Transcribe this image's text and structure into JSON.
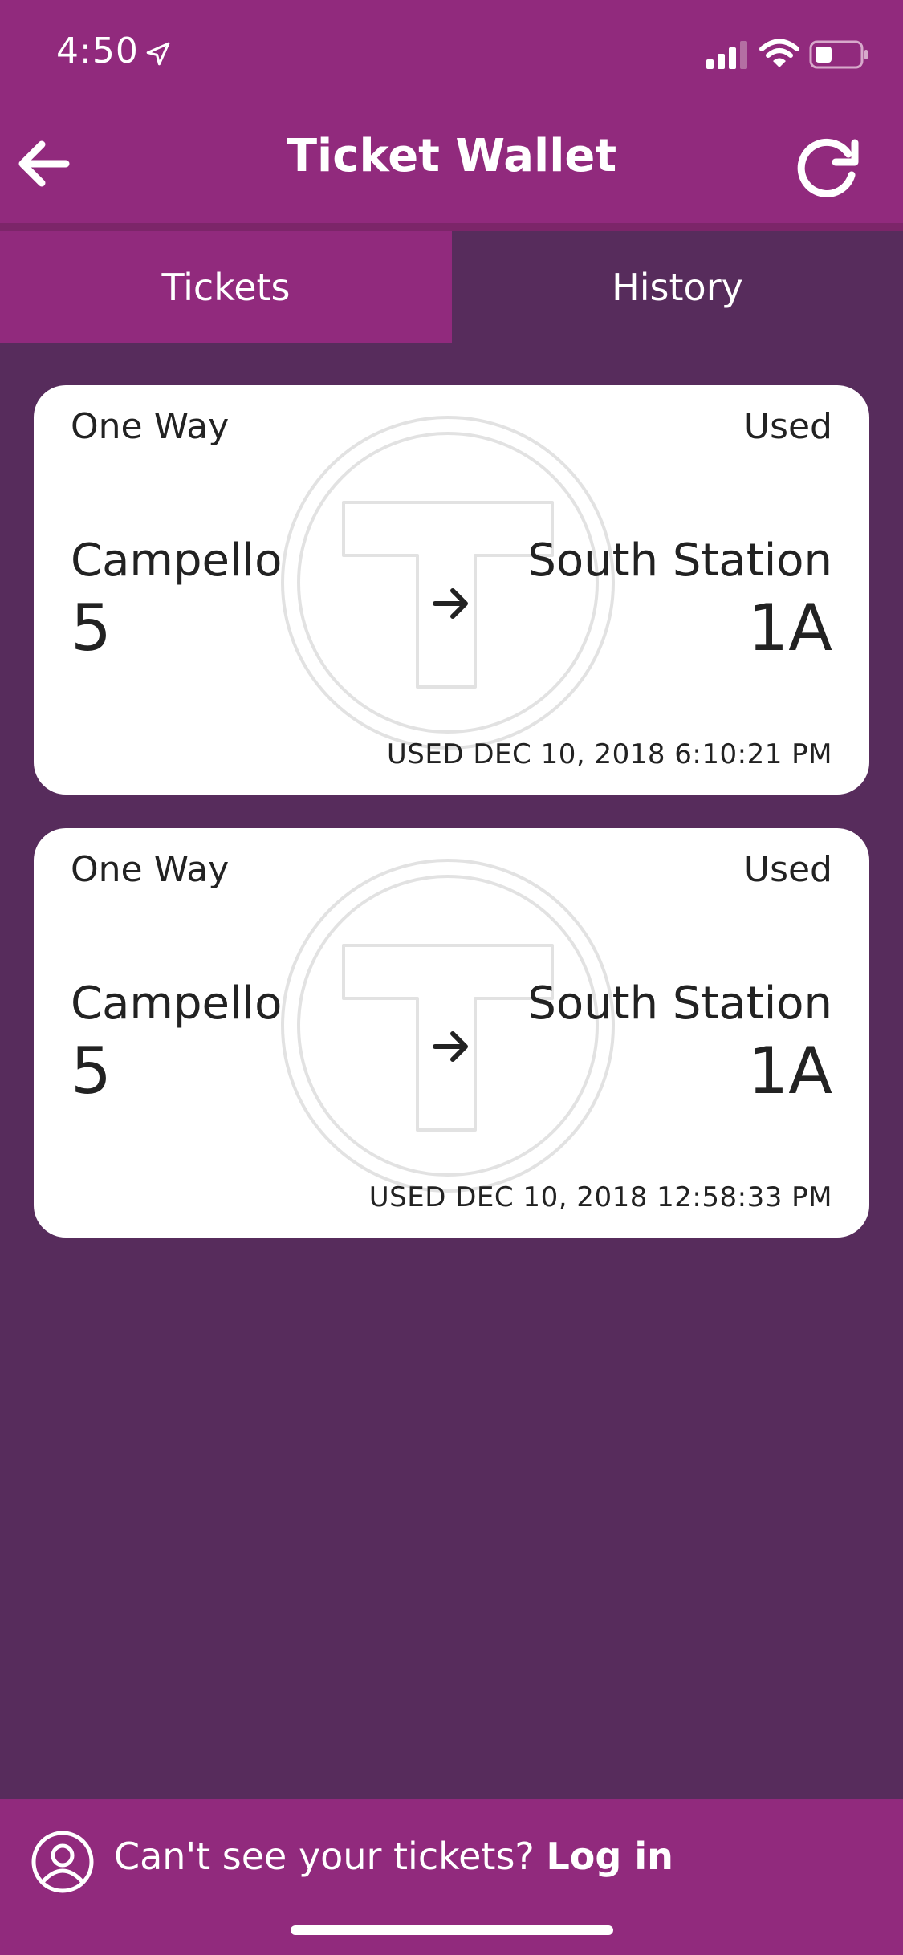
{
  "status_bar": {
    "time": "4:50"
  },
  "header": {
    "title": "Ticket Wallet"
  },
  "tabs": [
    {
      "label": "Tickets",
      "selected": true
    },
    {
      "label": "History",
      "selected": false
    }
  ],
  "tickets": [
    {
      "type": "One Way",
      "status": "Used",
      "origin": {
        "name": "Campello",
        "zone": "5"
      },
      "destination": {
        "name": "South Station",
        "zone": "1A"
      },
      "used_at": "USED DEC 10, 2018 6:10:21 PM"
    },
    {
      "type": "One Way",
      "status": "Used",
      "origin": {
        "name": "Campello",
        "zone": "5"
      },
      "destination": {
        "name": "South Station",
        "zone": "1A"
      },
      "used_at": "USED DEC 10, 2018 12:58:33 PM"
    }
  ],
  "footer": {
    "prompt": "Can't see your tickets?",
    "login_label": "Log in"
  },
  "colors": {
    "header": "#912a7d",
    "background": "#572c5c",
    "card": "#ffffff"
  },
  "icons": {
    "back": "arrow-left-icon",
    "refresh": "refresh-icon",
    "direction": "arrow-right-icon",
    "watermark": "mbta-t-logo",
    "account": "user-circle-icon"
  }
}
